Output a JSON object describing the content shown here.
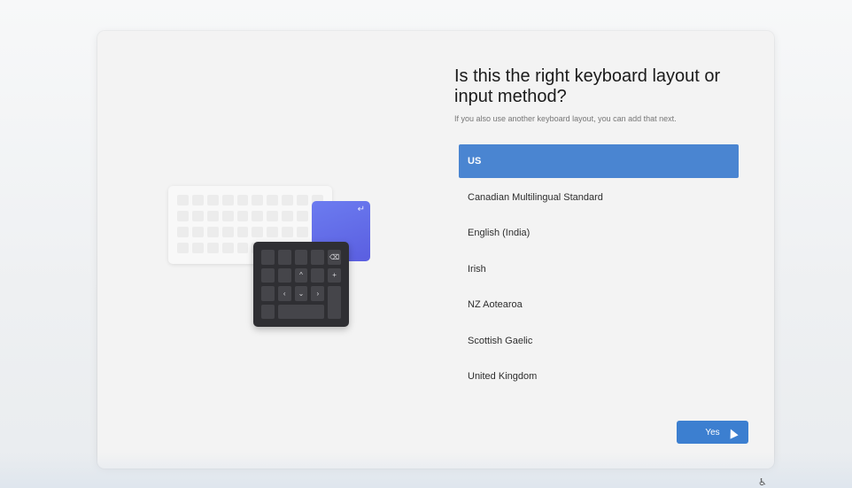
{
  "header": {
    "title": "Is this the right keyboard layout or input method?",
    "subtitle": "If you also use another keyboard layout, you can add that next."
  },
  "layouts": {
    "items": [
      {
        "label": "US",
        "selected": true
      },
      {
        "label": "Canadian Multilingual Standard",
        "selected": false
      },
      {
        "label": "English (India)",
        "selected": false
      },
      {
        "label": "Irish",
        "selected": false
      },
      {
        "label": "NZ Aotearoa",
        "selected": false
      },
      {
        "label": "Scottish Gaelic",
        "selected": false
      },
      {
        "label": "United Kingdom",
        "selected": false
      }
    ]
  },
  "footer": {
    "yes_label": "Yes"
  },
  "icons": {
    "enter_key": "enter-icon",
    "numpad_backspace": "⌫",
    "numpad_plus": "+",
    "numpad_up": "^",
    "numpad_left": "‹",
    "numpad_down": "⌄",
    "numpad_right": "›",
    "accessibility": "accessibility-icon"
  },
  "colors": {
    "accent": "#3c7fd0",
    "selected_row": "#4a85d1",
    "blue_key": "#5a5ee0",
    "numpad": "#2f2f33"
  }
}
